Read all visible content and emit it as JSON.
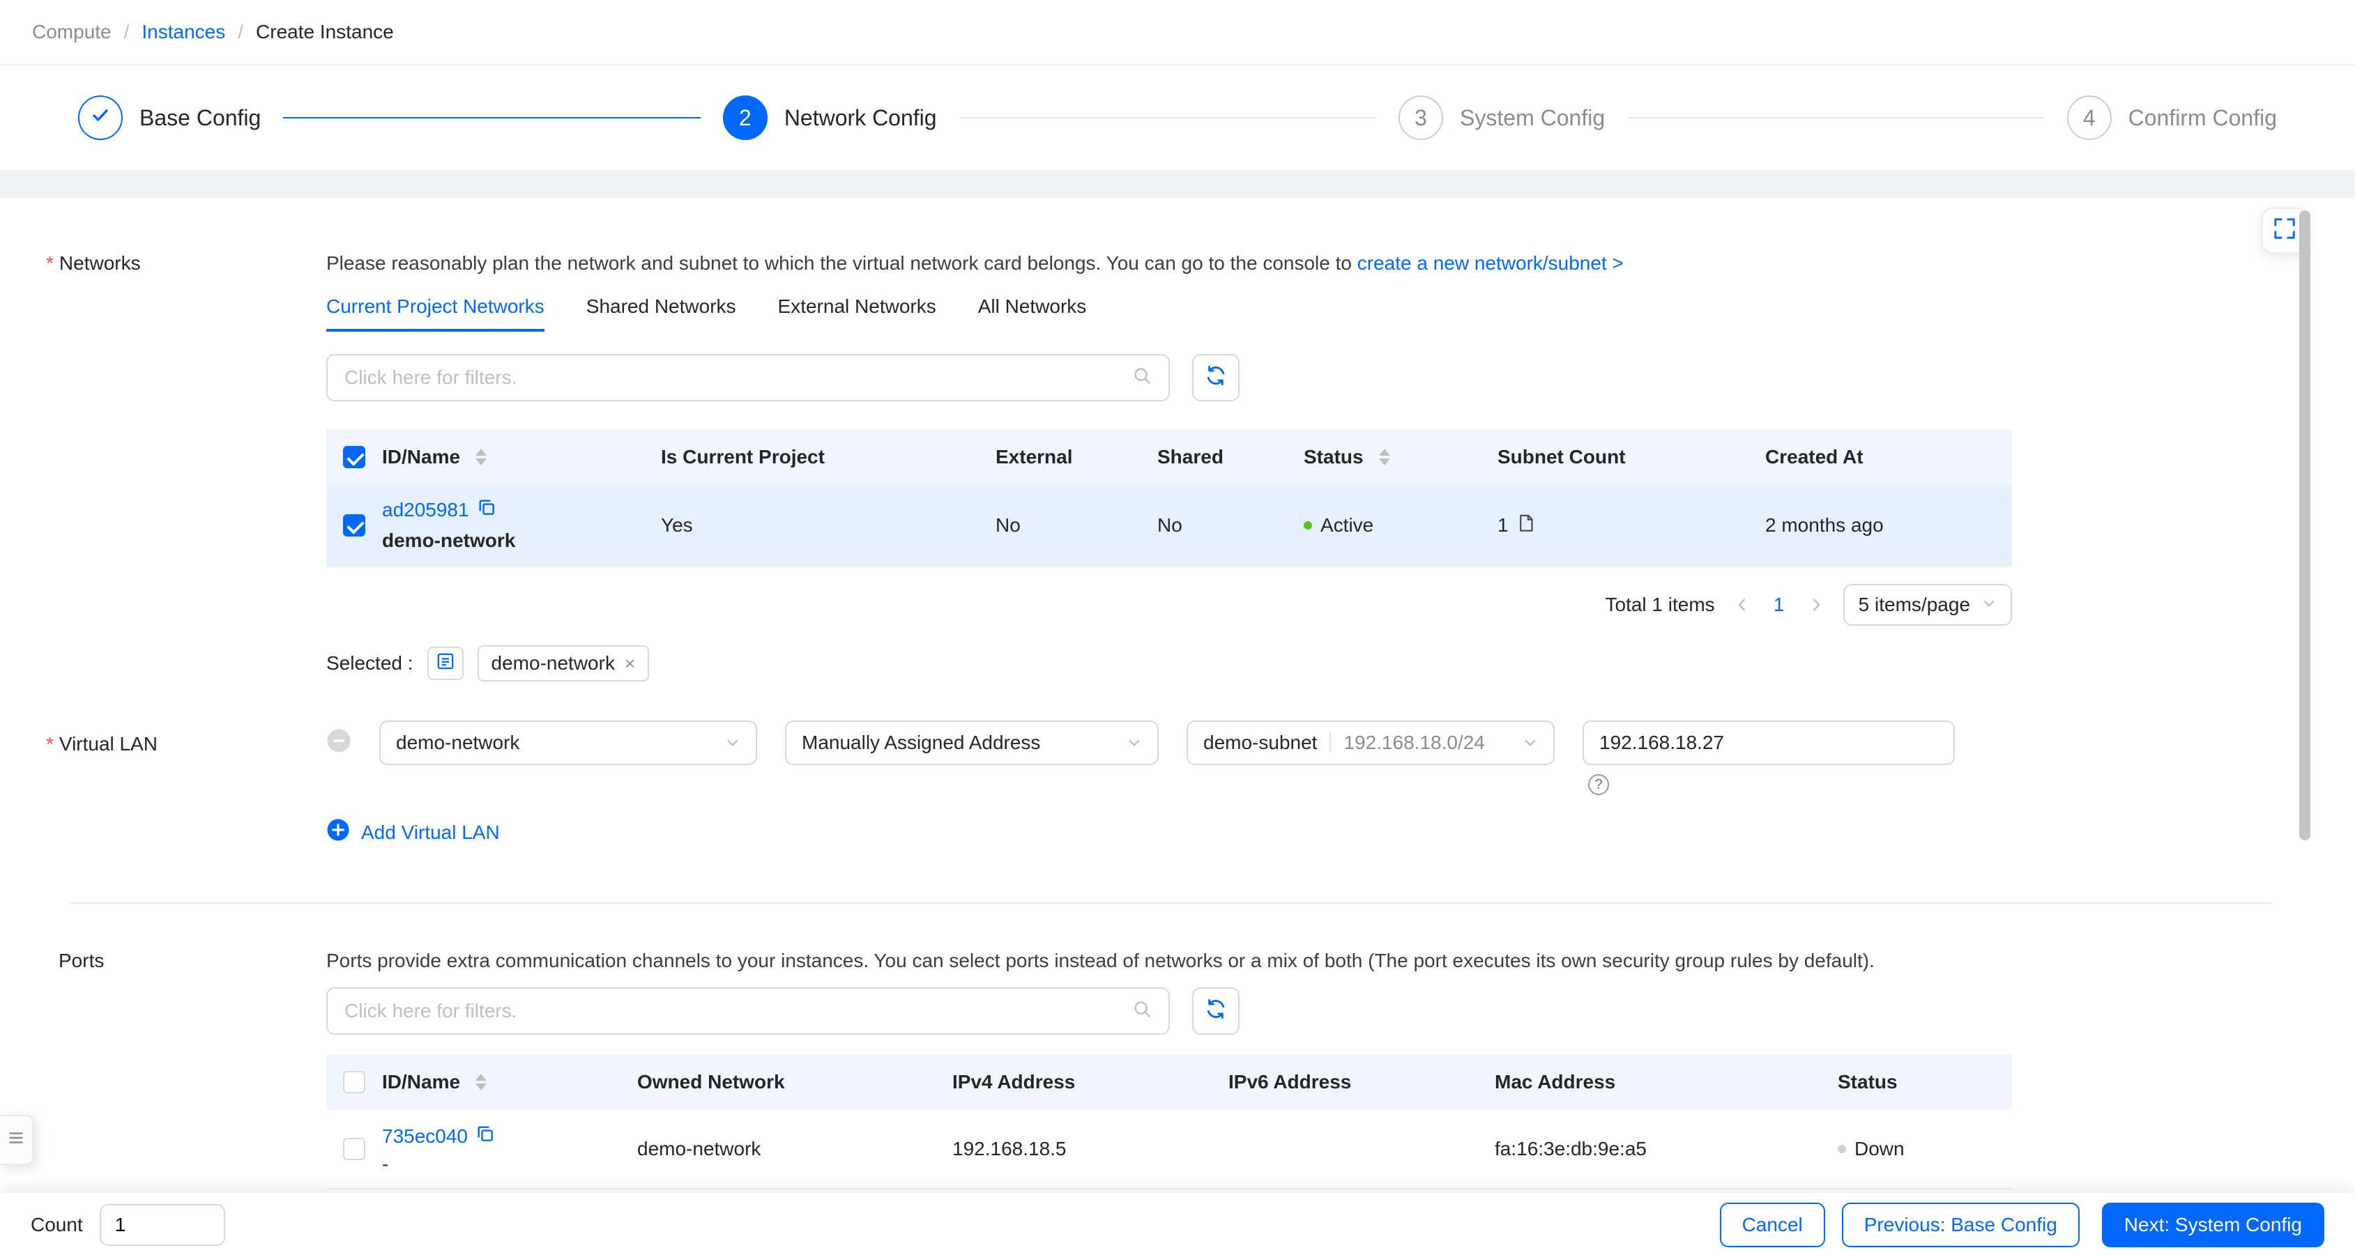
{
  "colors": {
    "primary": "#0068ff",
    "status_active": "#52c41a",
    "status_down": "#d2d2d2",
    "required_mark": "#ff4d4f",
    "table_header_bg": "#f0f6ff",
    "selected_row_bg": "#e6f1ff"
  },
  "common": {
    "required_mark": "*",
    "close_mark": "×",
    "question_mark": "?"
  },
  "breadcrumb": {
    "separator": "/",
    "items": [
      {
        "label": "Compute"
      },
      {
        "label": "Instances"
      },
      {
        "label": "Create Instance"
      }
    ]
  },
  "steps": [
    {
      "num": "",
      "label": "Base Config",
      "state": "done"
    },
    {
      "num": "2",
      "label": "Network Config",
      "state": "active"
    },
    {
      "num": "3",
      "label": "System Config",
      "state": "pending"
    },
    {
      "num": "4",
      "label": "Confirm Config",
      "state": "pending"
    }
  ],
  "networks": {
    "label": "Networks",
    "hint_text": "Please reasonably plan the network and subnet to which the virtual network card belongs. You can go to the console to ",
    "hint_link": "create a new network/subnet >",
    "tabs": [
      {
        "label": "Current Project Networks"
      },
      {
        "label": "Shared Networks"
      },
      {
        "label": "External Networks"
      },
      {
        "label": "All Networks"
      }
    ],
    "filter_placeholder": "Click here for filters.",
    "table": {
      "columns": [
        "ID/Name",
        "Is Current Project",
        "External",
        "Shared",
        "Status",
        "Subnet Count",
        "Created At"
      ],
      "rows": [
        {
          "id": "ad205981",
          "name": "demo-network",
          "is_current_project": "Yes",
          "external": "No",
          "shared": "No",
          "status": "Active",
          "subnet_count": "1",
          "created_at": "2 months ago"
        }
      ]
    },
    "pagination": {
      "total": "Total 1 items",
      "page": "1",
      "page_size": "5 items/page"
    },
    "selected_label": "Selected :",
    "selected_tag": "demo-network"
  },
  "virtual_lan": {
    "label": "Virtual LAN",
    "network_value": "demo-network",
    "assign_value": "Manually Assigned Address",
    "subnet_name": "demo-subnet",
    "subnet_cidr": "192.168.18.0/24",
    "ip_value": "192.168.18.27",
    "add_label": "Add Virtual LAN"
  },
  "ports": {
    "label": "Ports",
    "hint_text": "Ports provide extra communication channels to your instances. You can select ports instead of networks or a mix of both (The port executes its own security group rules by default).",
    "filter_placeholder": "Click here for filters.",
    "table": {
      "columns": [
        "ID/Name",
        "Owned Network",
        "IPv4 Address",
        "IPv6 Address",
        "Mac Address",
        "Status"
      ],
      "rows": [
        {
          "id": "735ec040",
          "name": "-",
          "owned_network": "demo-network",
          "ipv4": "192.168.18.5",
          "ipv6": "",
          "mac": "fa:16:3e:db:9e:a5",
          "status": "Down"
        }
      ]
    }
  },
  "footer": {
    "count_label": "Count",
    "count_value": "1",
    "cancel_label": "Cancel",
    "previous_label": "Previous: Base Config",
    "next_label": "Next: System Config"
  }
}
